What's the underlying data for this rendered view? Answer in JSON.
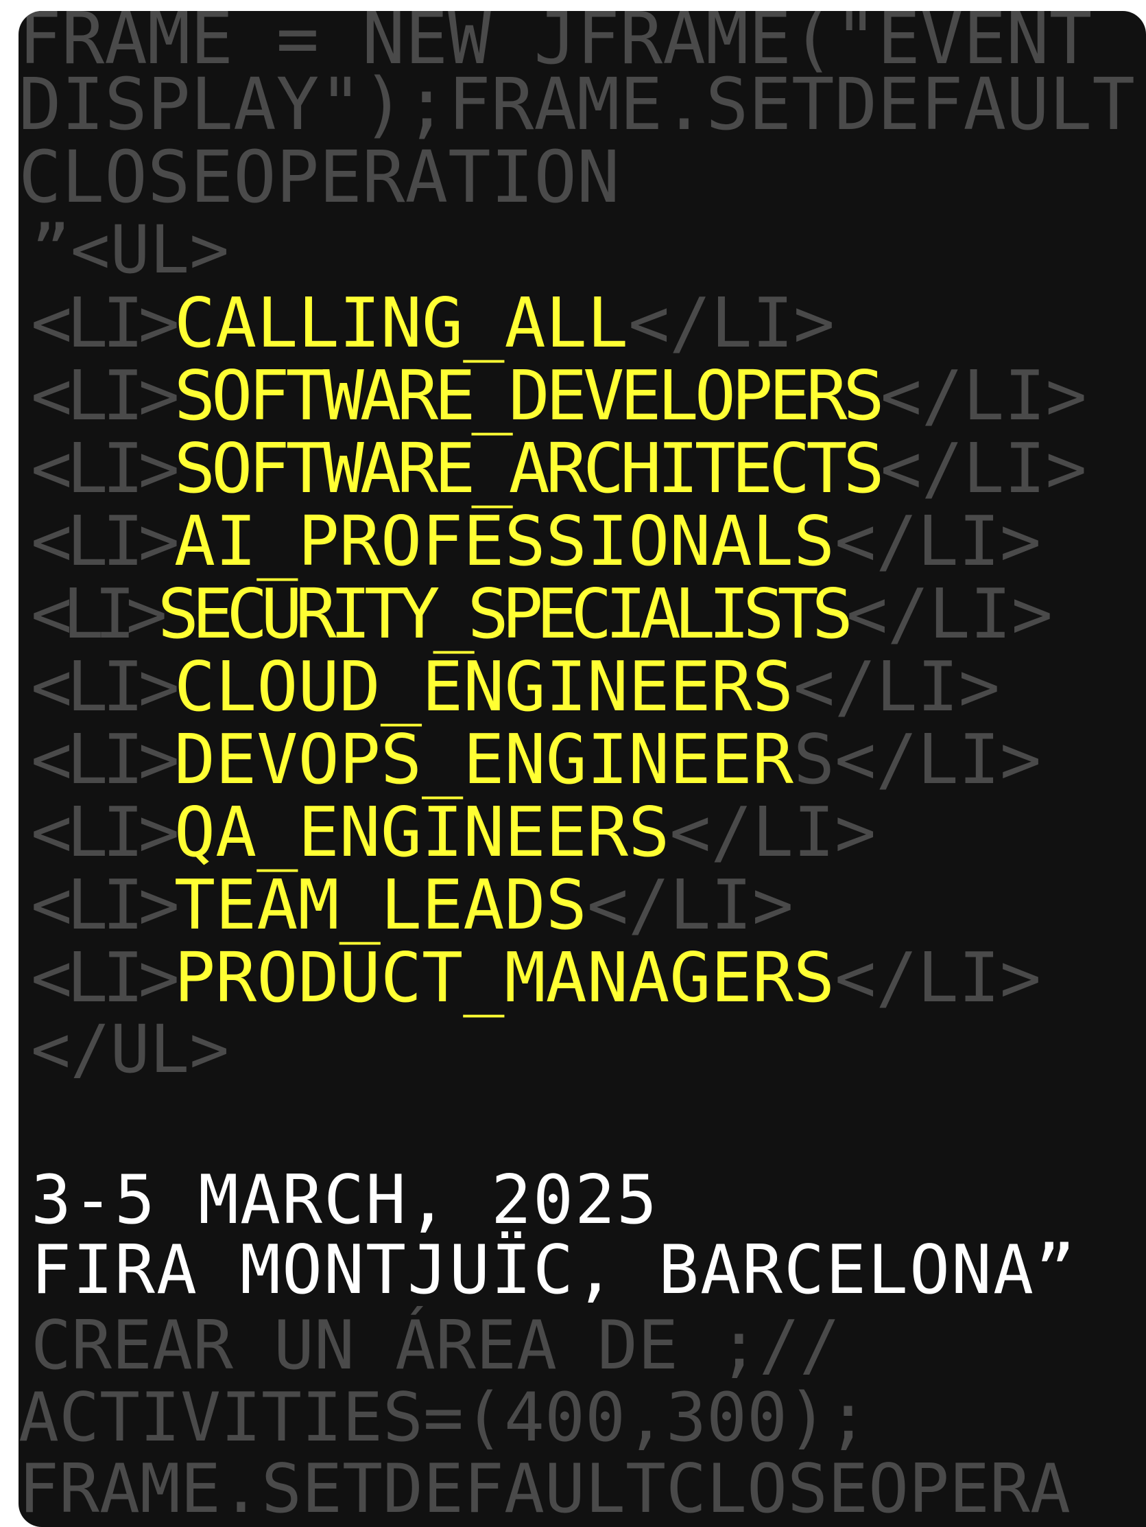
{
  "colors": {
    "background": "#111111",
    "code_text": "#4a4a4a",
    "highlight": "#ffff33",
    "date_text": "#ffffff"
  },
  "code_top": [
    "FRAME = NEW JFRAME(\"EVENT",
    "DISPLAY\");FRAME.SETDEFAULT",
    "CLOSEOPERATION"
  ],
  "list": {
    "open_tag": "”<UL>",
    "li_open": "<LI>",
    "li_close": "</LI>",
    "close_tag": "</UL>",
    "items": [
      "CALLING_ALL",
      "SOFTWARE_DEVELOPERS",
      "SOFTWARE_ARCHITECTS",
      "AI_PROFESSIONALS",
      "SECURITY_SPECIALISTS",
      "CLOUD_ENGINEERS",
      "DEVOPS_ENGINEER",
      "QA_ENGINEERS",
      "TEAM_LEADS",
      "PRODUCT_MANAGERS"
    ],
    "item_suffix": {
      "devops": "S"
    }
  },
  "event": {
    "dates": "3-5 MARCH, 2025",
    "venue": "FIRA MONTJUÏC, BARCELONA”"
  },
  "code_bottom": [
    "CREAR UN ÁREA DE  ;//",
    "ACTIVITIES=(400,300);",
    "FRAME.SETDEFAULTCLOSEOPERA"
  ]
}
